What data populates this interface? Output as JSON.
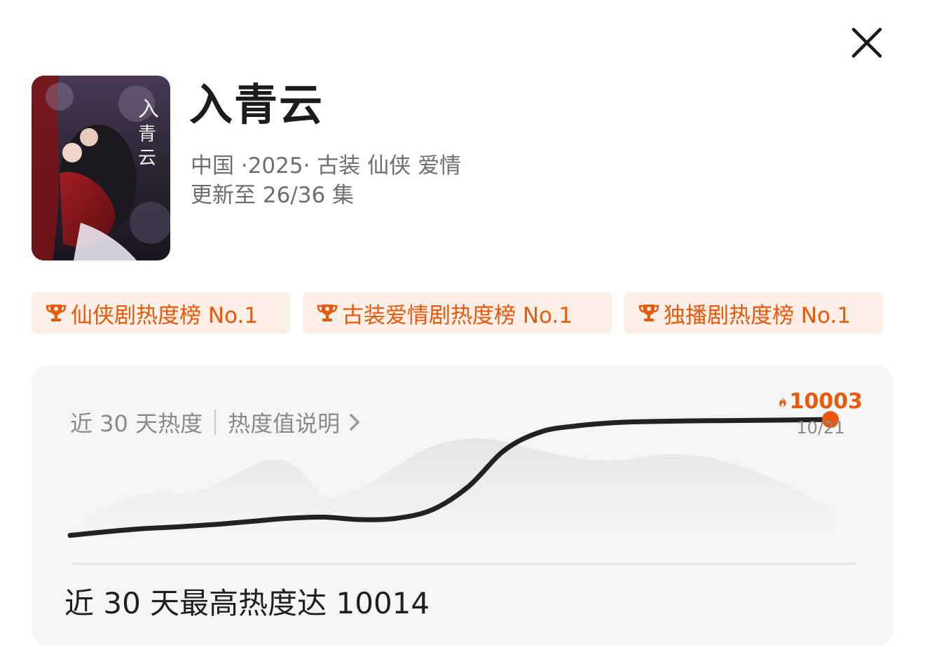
{
  "show": {
    "title": "入青云",
    "meta_line": "中国 ·2025· 古装 仙侠 爱情",
    "update_line": "更新至 26/36 集"
  },
  "badges": [
    {
      "label": "仙侠剧热度榜 No.1",
      "icon": "trophy-icon"
    },
    {
      "label": "古装爱情剧热度榜 No.1",
      "icon": "trophy-icon"
    },
    {
      "label": "独播剧热度榜 No.1",
      "icon": "trophy-icon"
    }
  ],
  "heat_card": {
    "heading": "近 30 天热度",
    "explain_link": "热度值说明",
    "latest_value": "10003",
    "latest_date": "10/21",
    "summary": "近 30 天最高热度达 10014"
  },
  "colors": {
    "accent": "#e8590c",
    "badge_bg": "#fdeee6",
    "card_bg": "#f5f5f5",
    "line": "#222222"
  },
  "icons": {
    "close": "close-icon",
    "fire": "fire-icon",
    "chevron": "chevron-right-icon"
  },
  "chart_data": {
    "type": "line",
    "series": [
      {
        "values": [
          8100,
          8160,
          8210,
          8240,
          8280,
          8330,
          8380,
          8400,
          8360,
          8380,
          8520,
          8900,
          9500,
          9800,
          9900,
          9950,
          9970,
          9980,
          9985,
          9990,
          9995,
          10003
        ]
      }
    ],
    "ylim": [
      7900,
      10200
    ],
    "highlight_last": true
  }
}
